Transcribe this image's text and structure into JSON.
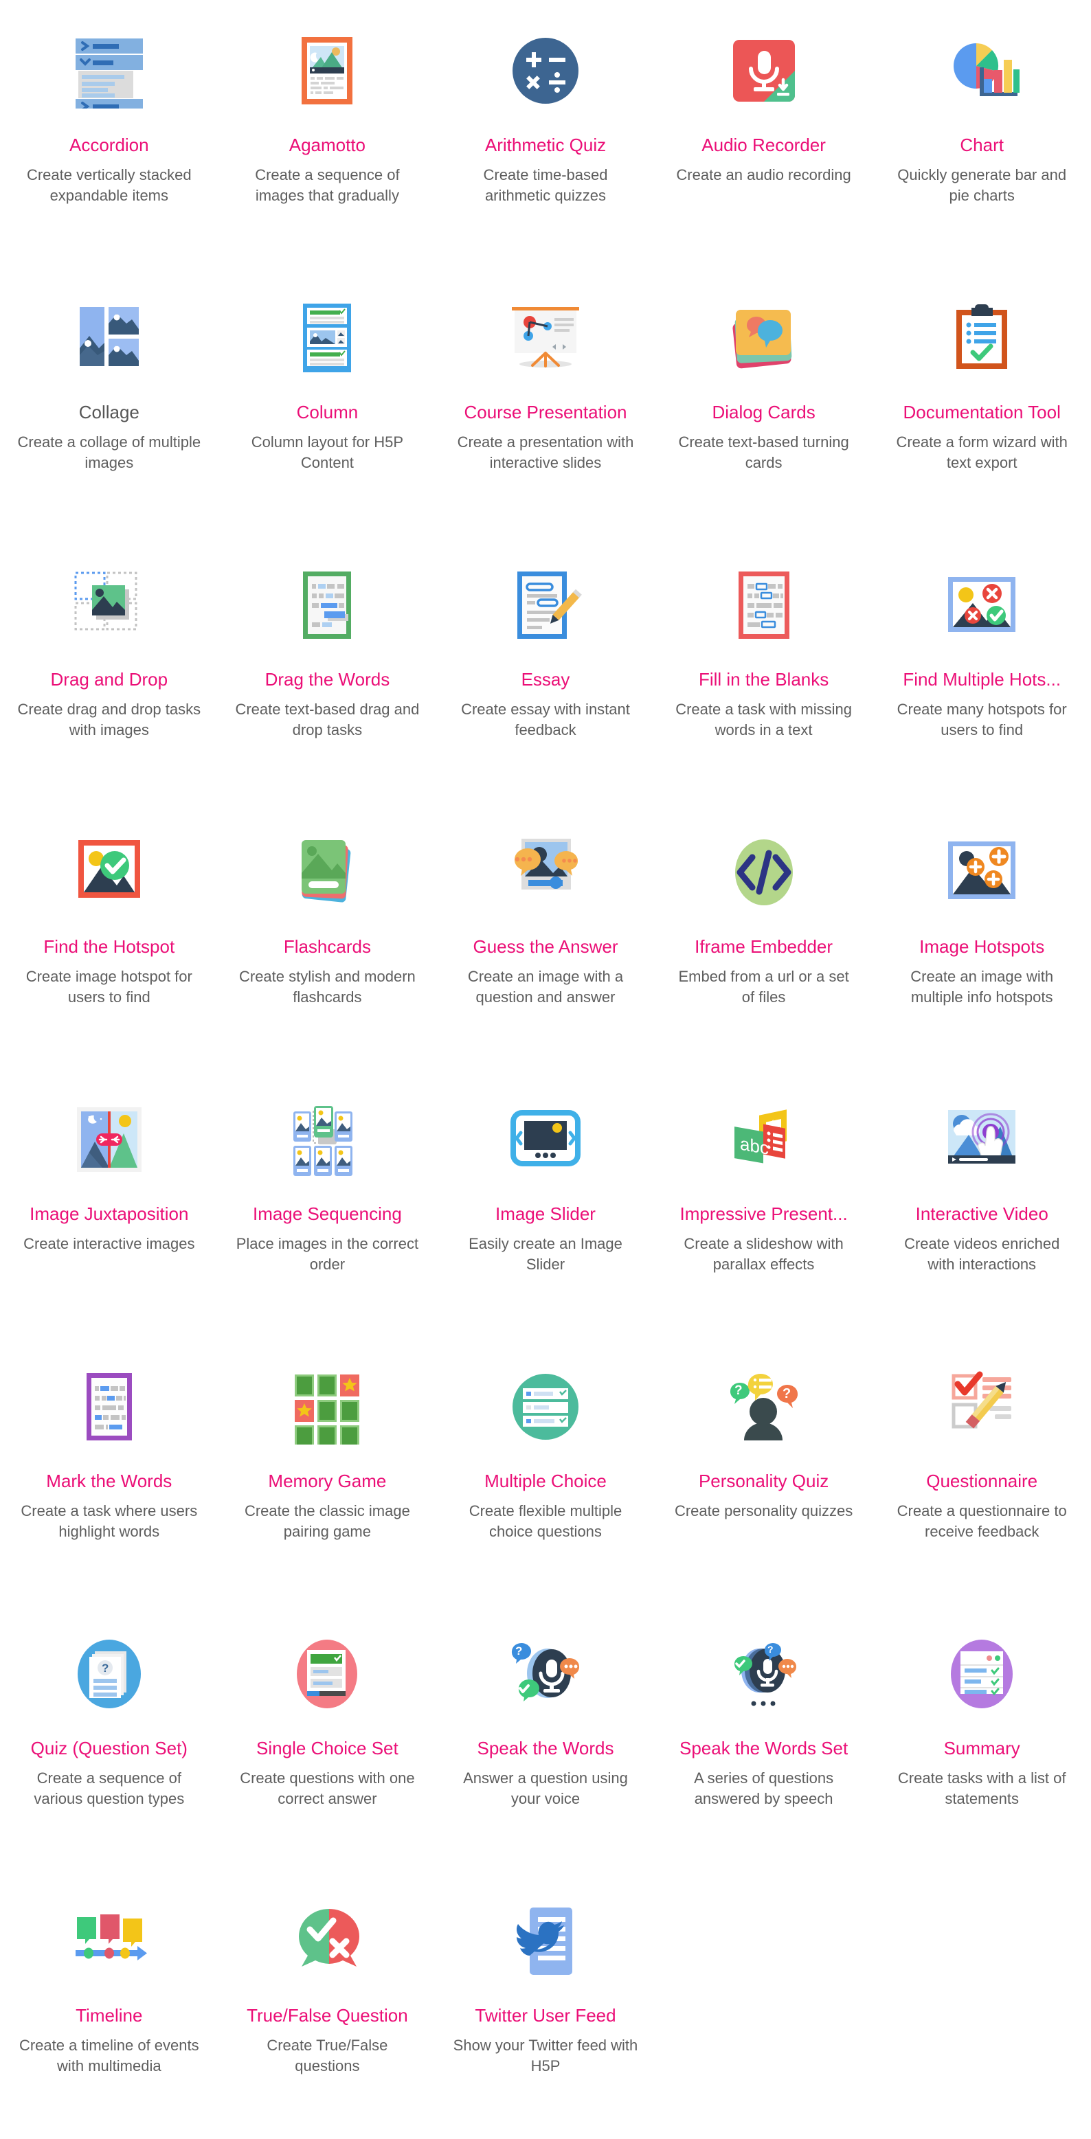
{
  "colors": {
    "title_link": "#eb0f77",
    "title_plain": "#565656",
    "description": "#5e5e5e",
    "background": "#ffffff"
  },
  "grid": {
    "columns": 5,
    "total_items": 38
  },
  "items": [
    {
      "icon": "accordion-icon",
      "title": "Accordion",
      "description": "Create vertically stacked expandable items",
      "link": true
    },
    {
      "icon": "agamotto-icon",
      "title": "Agamotto",
      "description": "Create a sequence of images that gradually",
      "link": true
    },
    {
      "icon": "arithmetic-quiz-icon",
      "title": "Arithmetic Quiz",
      "description": "Create time-based arithmetic quizzes",
      "link": true
    },
    {
      "icon": "audio-recorder-icon",
      "title": "Audio Recorder",
      "description": "Create an audio recording",
      "link": true
    },
    {
      "icon": "chart-icon",
      "title": "Chart",
      "description": "Quickly generate bar and pie charts",
      "link": true
    },
    {
      "icon": "collage-icon",
      "title": "Collage",
      "description": "Create a collage of multiple images",
      "link": false
    },
    {
      "icon": "column-icon",
      "title": "Column",
      "description": "Column layout for H5P Content",
      "link": true
    },
    {
      "icon": "course-presentation-icon",
      "title": "Course Presentation",
      "description": "Create a presentation with interactive slides",
      "link": true
    },
    {
      "icon": "dialog-cards-icon",
      "title": "Dialog Cards",
      "description": "Create text-based turning cards",
      "link": true
    },
    {
      "icon": "documentation-tool-icon",
      "title": "Documentation Tool",
      "description": "Create a form wizard with text export",
      "link": true
    },
    {
      "icon": "drag-and-drop-icon",
      "title": "Drag and Drop",
      "description": "Create drag and drop tasks with images",
      "link": true
    },
    {
      "icon": "drag-the-words-icon",
      "title": "Drag the Words",
      "description": "Create text-based drag and drop tasks",
      "link": true
    },
    {
      "icon": "essay-icon",
      "title": "Essay",
      "description": "Create essay with instant feedback",
      "link": true
    },
    {
      "icon": "fill-in-the-blanks-icon",
      "title": "Fill in the Blanks",
      "description": "Create a task with missing words in a text",
      "link": true
    },
    {
      "icon": "find-multiple-hotspots-icon",
      "title": "Find Multiple Hots...",
      "description": "Create many hotspots for users to find",
      "link": true
    },
    {
      "icon": "find-the-hotspot-icon",
      "title": "Find the Hotspot",
      "description": "Create image hotspot for users to find",
      "link": true
    },
    {
      "icon": "flashcards-icon",
      "title": "Flashcards",
      "description": "Create stylish and modern flashcards",
      "link": true
    },
    {
      "icon": "guess-the-answer-icon",
      "title": "Guess the Answer",
      "description": "Create an image with a question and answer",
      "link": true
    },
    {
      "icon": "iframe-embedder-icon",
      "title": "Iframe Embedder",
      "description": "Embed from a url or a set of files",
      "link": true
    },
    {
      "icon": "image-hotspots-icon",
      "title": "Image Hotspots",
      "description": "Create an image with multiple info hotspots",
      "link": true
    },
    {
      "icon": "image-juxtaposition-icon",
      "title": "Image Juxtaposition",
      "description": "Create interactive images",
      "link": true
    },
    {
      "icon": "image-sequencing-icon",
      "title": "Image Sequencing",
      "description": "Place images in the correct order",
      "link": true
    },
    {
      "icon": "image-slider-icon",
      "title": "Image Slider",
      "description": "Easily create an Image Slider",
      "link": true
    },
    {
      "icon": "impressive-presentation-icon",
      "title": "Impressive Present...",
      "description": "Create a slideshow with parallax effects",
      "link": true
    },
    {
      "icon": "interactive-video-icon",
      "title": "Interactive Video",
      "description": "Create videos enriched with interactions",
      "link": true
    },
    {
      "icon": "mark-the-words-icon",
      "title": "Mark the Words",
      "description": "Create a task where users highlight words",
      "link": true
    },
    {
      "icon": "memory-game-icon",
      "title": "Memory Game",
      "description": "Create the classic image pairing game",
      "link": true
    },
    {
      "icon": "multiple-choice-icon",
      "title": "Multiple Choice",
      "description": "Create flexible multiple choice questions",
      "link": true
    },
    {
      "icon": "personality-quiz-icon",
      "title": "Personality Quiz",
      "description": "Create personality quizzes",
      "link": true
    },
    {
      "icon": "questionnaire-icon",
      "title": "Questionnaire",
      "description": "Create a questionnaire to receive feedback",
      "link": true
    },
    {
      "icon": "quiz-question-set-icon",
      "title": "Quiz (Question Set)",
      "description": "Create a sequence of various question types",
      "link": true
    },
    {
      "icon": "single-choice-set-icon",
      "title": "Single Choice Set",
      "description": "Create questions with one correct answer",
      "link": true
    },
    {
      "icon": "speak-the-words-icon",
      "title": "Speak the Words",
      "description": "Answer a question using your voice",
      "link": true
    },
    {
      "icon": "speak-the-words-set-icon",
      "title": "Speak the Words Set",
      "description": "A series of questions answered by speech",
      "link": true
    },
    {
      "icon": "summary-icon",
      "title": "Summary",
      "description": "Create tasks with a list of statements",
      "link": true
    },
    {
      "icon": "timeline-icon",
      "title": "Timeline",
      "description": "Create a timeline of events with multimedia",
      "link": true
    },
    {
      "icon": "true-false-question-icon",
      "title": "True/False Question",
      "description": "Create True/False questions",
      "link": true
    },
    {
      "icon": "twitter-user-feed-icon",
      "title": "Twitter User Feed",
      "description": "Show your Twitter feed with H5P",
      "link": true
    }
  ]
}
